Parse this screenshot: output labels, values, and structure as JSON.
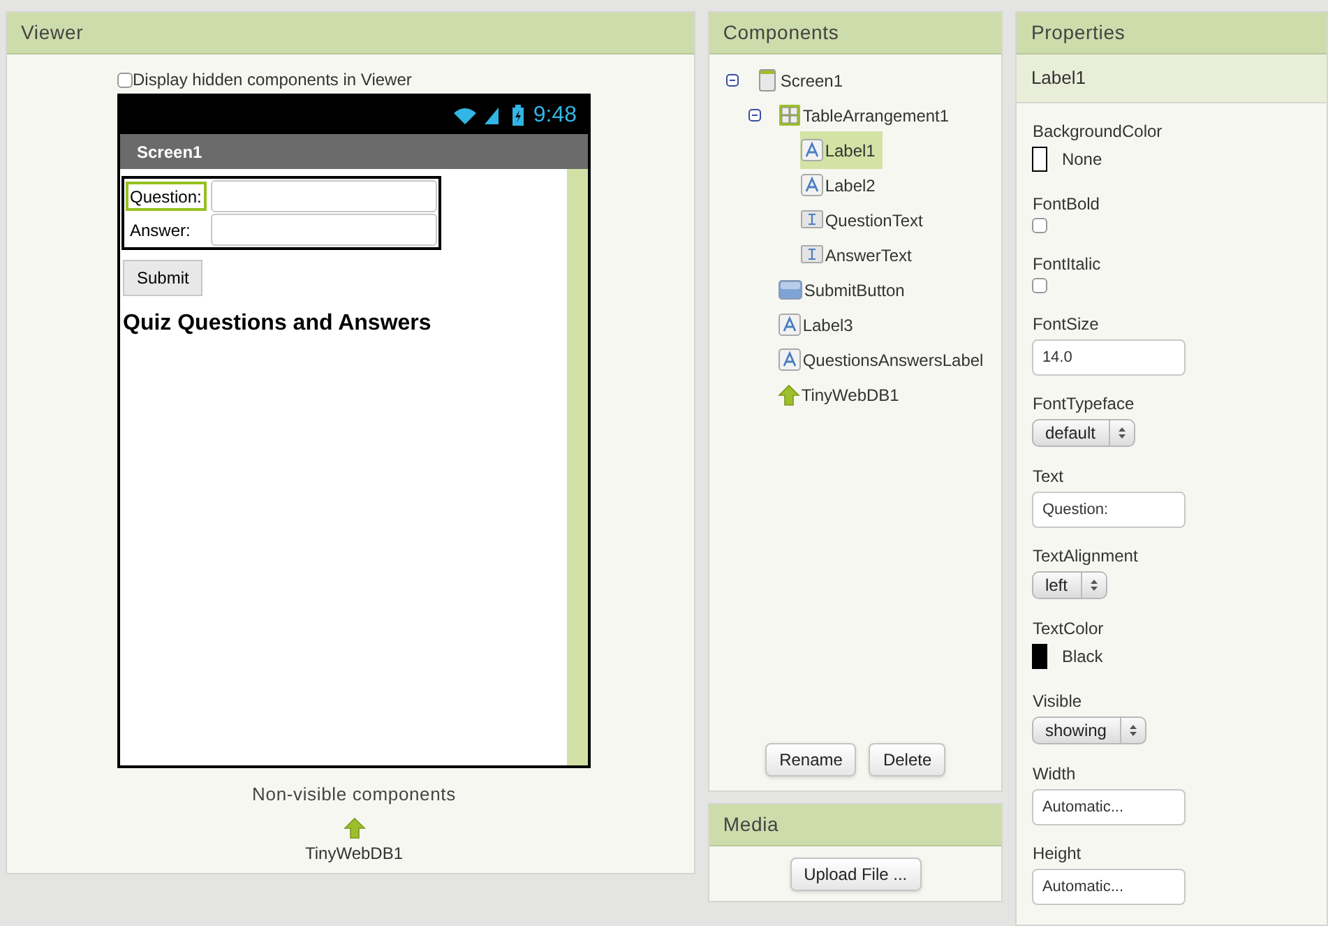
{
  "viewer": {
    "title": "Viewer",
    "show_hidden": {
      "label": "Display hidden components in Viewer",
      "checked": false
    },
    "phone": {
      "time": "9:48",
      "title": "Screen1",
      "table": [
        {
          "label": "Question:",
          "selected": true
        },
        {
          "label": "Answer:",
          "selected": false
        }
      ],
      "button": "Submit",
      "heading": "Quiz Questions and Answers"
    },
    "nonvisible": {
      "title": "Non-visible components",
      "items": [
        {
          "label": "TinyWebDB1",
          "kind": "tinywebdb"
        }
      ]
    }
  },
  "components": {
    "title": "Components",
    "tree": [
      {
        "label": "Screen1",
        "kind": "screen",
        "selected": false,
        "expanded": true,
        "children": [
          {
            "label": "TableArrangement1",
            "kind": "table",
            "selected": false,
            "expanded": true,
            "children": [
              {
                "label": "Label1",
                "kind": "label",
                "selected": true
              },
              {
                "label": "Label2",
                "kind": "label",
                "selected": false
              },
              {
                "label": "QuestionText",
                "kind": "textbox",
                "selected": false
              },
              {
                "label": "AnswerText",
                "kind": "textbox",
                "selected": false
              }
            ]
          },
          {
            "label": "SubmitButton",
            "kind": "button",
            "selected": false
          },
          {
            "label": "Label3",
            "kind": "label",
            "selected": false
          },
          {
            "label": "QuestionsAnswersLabel",
            "kind": "label",
            "selected": false
          },
          {
            "label": "TinyWebDB1",
            "kind": "tinywebdb",
            "selected": false
          }
        ]
      }
    ],
    "buttons": [
      "Rename",
      "Delete"
    ]
  },
  "media": {
    "title": "Media",
    "button": "Upload File ..."
  },
  "properties": {
    "title": "Properties",
    "component": "Label1",
    "items": [
      {
        "kind": "color",
        "label": "BackgroundColor",
        "value": "None",
        "color": "#ffffff"
      },
      {
        "kind": "checkbox",
        "label": "FontBold",
        "checked": false
      },
      {
        "kind": "checkbox",
        "label": "FontItalic",
        "checked": false
      },
      {
        "kind": "text",
        "label": "FontSize",
        "value": "14.0"
      },
      {
        "kind": "select",
        "label": "FontTypeface",
        "value": "default"
      },
      {
        "kind": "text",
        "label": "Text",
        "value": "Question:"
      },
      {
        "kind": "select",
        "label": "TextAlignment",
        "value": "left"
      },
      {
        "kind": "color",
        "label": "TextColor",
        "value": "Black",
        "color": "#000000"
      },
      {
        "kind": "select",
        "label": "Visible",
        "value": "showing"
      },
      {
        "kind": "text",
        "label": "Width",
        "value": "Automatic..."
      },
      {
        "kind": "text",
        "label": "Height",
        "value": "Automatic..."
      }
    ]
  }
}
